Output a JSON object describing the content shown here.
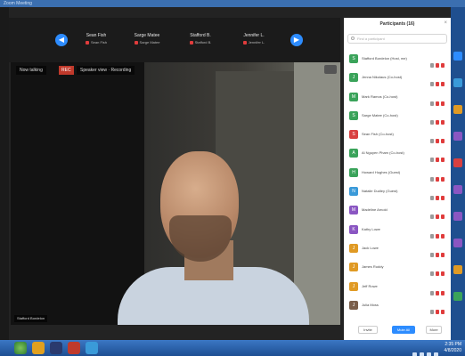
{
  "window": {
    "title": "Zoom Meeting"
  },
  "share_bar": {
    "thumbnails": [
      {
        "name": "Sean Fish",
        "sub": "Sean Fish"
      },
      {
        "name": "Sarge Matee",
        "sub": "Sarge Matee"
      },
      {
        "name": "Stafford B.",
        "sub": "Stafford B."
      },
      {
        "name": "Jennifer L.",
        "sub": "Jennifer L."
      }
    ]
  },
  "video": {
    "speaker_label": "Now talking",
    "rec_label": "REC",
    "view_label": "Speaker view · Recording",
    "name_tag": "Stafford Bordelon"
  },
  "panel": {
    "title": "Participants (16)",
    "search_placeholder": "Find a participant",
    "participants": [
      {
        "name": "Stafford Bordelon (Host, me)",
        "initial": "S",
        "color": "#3aa35a"
      },
      {
        "name": "Jenna Nikolaus (Co-host)",
        "initial": "J",
        "color": "#3aa35a"
      },
      {
        "name": "Mark Ramos (Co-host)",
        "initial": "M",
        "color": "#3aa35a"
      },
      {
        "name": "Sarge Matee (Co-host)",
        "initial": "S",
        "color": "#3aa35a"
      },
      {
        "name": "Sean Fish (Co-host)",
        "initial": "S",
        "color": "#d94040"
      },
      {
        "name": "Al Nguyen Pham (Co-host)",
        "initial": "A",
        "color": "#3aa35a"
      },
      {
        "name": "Howard Hughes (Guest)",
        "initial": "H",
        "color": "#3aa35a"
      },
      {
        "name": "Natalie Dudley (Guest)",
        "initial": "N",
        "color": "#3a9ad9"
      },
      {
        "name": "Madeline Arnold",
        "initial": "M",
        "color": "#8a56c2"
      },
      {
        "name": "Kathy Lowe",
        "initial": "K",
        "color": "#8a56c2"
      },
      {
        "name": "Jack Lowe",
        "initial": "J",
        "color": "#e09a24"
      },
      {
        "name": "James Ruddy",
        "initial": "J",
        "color": "#e09a24"
      },
      {
        "name": "Jeff Rowe",
        "initial": "J",
        "color": "#e09a24"
      },
      {
        "name": "Julia Moss",
        "initial": "J",
        "color": "#7a5e4a"
      }
    ],
    "footer": {
      "invite_label": "Invite",
      "mute_all_label": "Mute All",
      "more_label": "More"
    }
  },
  "taskbar": {
    "time": "2:35 PM",
    "date": "4/8/2020"
  }
}
